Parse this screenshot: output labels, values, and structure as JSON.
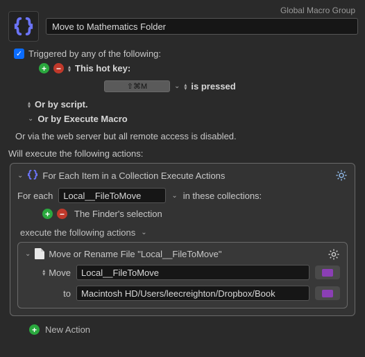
{
  "header": {
    "group_label": "Global Macro Group",
    "title": "Move to Mathematics Folder"
  },
  "trigger": {
    "label": "Triggered by any of the following:",
    "hotkey_label": "This hot key:",
    "hotkey_value": "⇧⌘M",
    "pressed_label": "is pressed",
    "script_label": "Or by script.",
    "exec_macro_label": "Or by Execute Macro",
    "web_label": "Or via the web server but all remote access is disabled."
  },
  "actions_header": "Will execute the following actions:",
  "foreach": {
    "title": "For Each Item in a Collection Execute Actions",
    "for_each_label": "For each",
    "variable": "Local__FileToMove",
    "in_label": "in these collections:",
    "collection_label": "The Finder's selection",
    "execute_label": "execute the following actions"
  },
  "move": {
    "title": "Move or Rename File \"Local__FileToMove\"",
    "op_label": "Move",
    "source": "Local__FileToMove",
    "to_label": "to",
    "dest": "Macintosh HD/Users/leecreighton/Dropbox/Book"
  },
  "footer": {
    "new_action_label": "New Action"
  }
}
